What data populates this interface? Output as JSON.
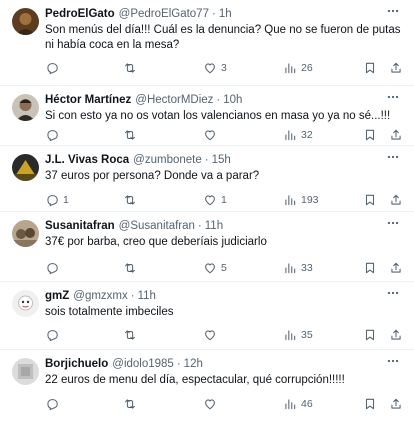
{
  "tweets": [
    {
      "name": "PedroElGato",
      "handle": "@PedroElGato77",
      "time": "1h",
      "text": "Son menús del día!!! Cuál es la denuncia? Que no se fueron de putas ni había coca en la mesa?",
      "replies": "",
      "retweets": "",
      "likes": "3",
      "views": "26",
      "avatar_color": "#6b4a2a"
    },
    {
      "name": "Héctor Martínez",
      "handle": "@HectorMDiez",
      "time": "10h",
      "text": "Si con esto ya no os votan los valencianos en masa yo ya no sé...!!!",
      "replies": "",
      "retweets": "",
      "likes": "",
      "views": "32",
      "avatar_color": "#7a6a5a"
    },
    {
      "name": "J.L. Vivas Roca",
      "handle": "@zumbonete",
      "time": "15h",
      "text": "37 euros por persona? Donde va a parar?",
      "replies": "1",
      "retweets": "",
      "likes": "1",
      "views": "193",
      "avatar_color": "#c9a227"
    },
    {
      "name": "Susanitafran",
      "handle": "@Susanitafran",
      "time": "11h",
      "text": "37€ por barba, creo que deberíais judiciarlo",
      "replies": "",
      "retweets": "",
      "likes": "5",
      "views": "33",
      "avatar_color": "#8a7560"
    },
    {
      "name": "gmZ",
      "handle": "@gmzxmx",
      "time": "11h",
      "text": "sois totalmente imbeciles",
      "replies": "",
      "retweets": "",
      "likes": "",
      "views": "35",
      "avatar_color": "#e5e5e5"
    },
    {
      "name": "Borjichuelo",
      "handle": "@idolo1985",
      "time": "12h",
      "text": "22 euros de menu del día, espectacular, qué corrupción!!!!!",
      "replies": "",
      "retweets": "",
      "likes": "",
      "views": "46",
      "avatar_color": "#d8d8d8"
    }
  ],
  "separator": "·"
}
